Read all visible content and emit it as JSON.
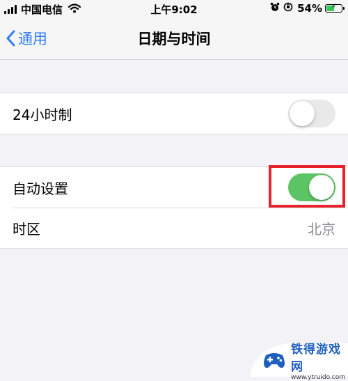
{
  "status_bar": {
    "carrier": "中国电信",
    "time": "上午9:02",
    "battery_percent_text": "54%",
    "battery_level": 0.54,
    "icons": [
      "signal-icon",
      "wifi-icon",
      "alarm-icon",
      "orientation-lock-icon",
      "battery-charging-icon"
    ]
  },
  "nav": {
    "back_label": "通用",
    "title": "日期与时间"
  },
  "settings": {
    "group1": {
      "hour24": {
        "label": "24小时制",
        "state": "off"
      }
    },
    "group2": {
      "auto_set": {
        "label": "自动设置",
        "state": "on"
      },
      "timezone": {
        "label": "时区",
        "value": "北京"
      }
    }
  },
  "colors": {
    "accent": "#2f7cf6",
    "toggle_on": "#5bc464",
    "toggle_off": "#e9e9ea",
    "highlight": "#e8212b",
    "background": "#f2f2f7"
  },
  "watermark": {
    "name": "铁得游戏网",
    "url": "www.ytruido.com"
  }
}
